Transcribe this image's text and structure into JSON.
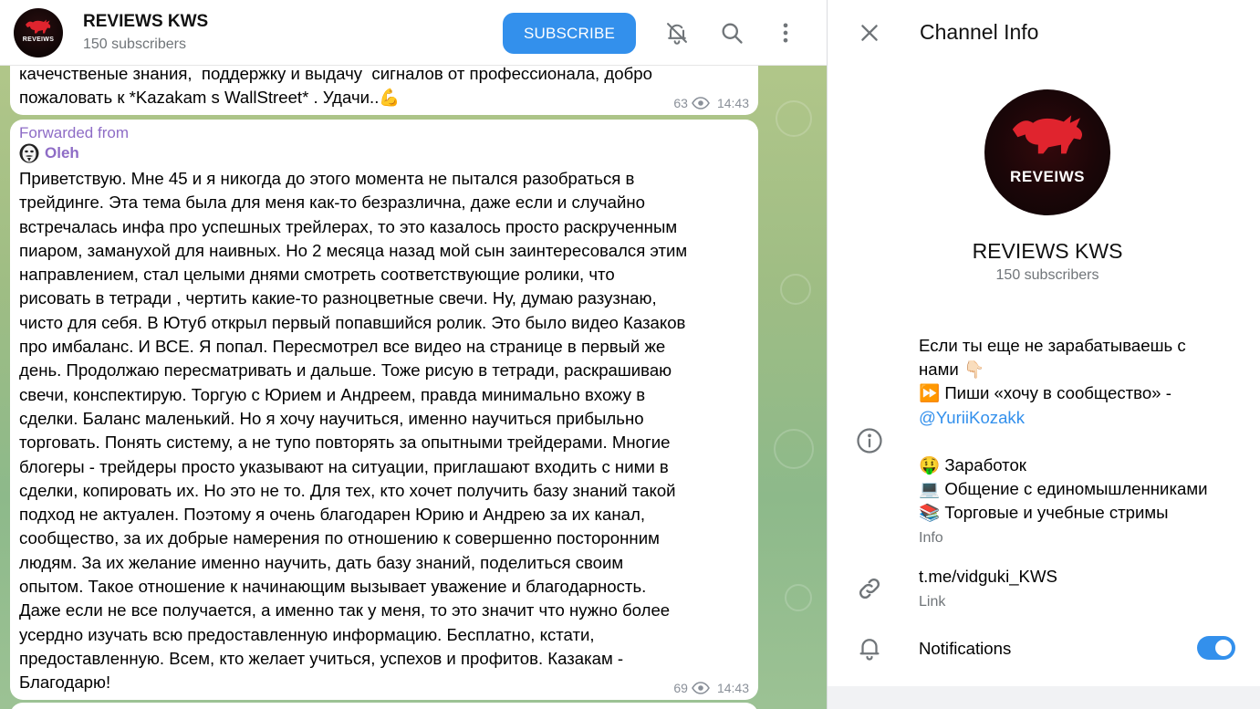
{
  "header": {
    "channel_name": "REVIEWS KWS",
    "subscribers": "150 subscribers",
    "avatar_brand": "REVEIWS",
    "subscribe_label": "SUBSCRIBE",
    "icons": [
      "bell-muted-icon",
      "search-icon",
      "more-vertical-icon"
    ]
  },
  "messages": [
    {
      "text": "качечственые знания,  поддержку и выдачу  сигналов от профессионала, добро\nпожаловать к *Kazakam s WallStreet* . Удачи..💪",
      "views": "63",
      "time": "14:43"
    },
    {
      "forwarded_label": "Forwarded from",
      "forwarded_author": "Oleh",
      "text": "Приветствую. Мне 45 и я никогда до этого момента не пытался разобраться в\nтрейдинге. Эта тема была для меня как-то безразлична, даже если и случайно\nвстречалась инфа про успешных трейлерах, то это казалось просто раскрученным\nпиаром, заманухой для наивных. Но 2 месяца назад мой сын заинтересовался этим\nнаправлением, стал целыми днями смотреть соответствующие ролики, что\nрисовать в тетради , чертить какие-то разноцветные свечи. Ну, думаю разузнаю,\nчисто для себя. В Ютуб открыл первый попавшийся ролик. Это было видео Казаков\nпро имбаланс. И ВСЕ. Я попал. Пересмотрел все видео на странице в первый же\nдень. Продолжаю пересматривать и дальше. Тоже рисую в тетради, раскрашиваю\nсвечи, конспектирую. Торгую с Юрием и Андреем, правда минимально вхожу в\nсделки. Баланс маленький. Но я хочу научиться, именно научиться прибыльно\nторговать. Понять систему, а не тупо повторять за опытными трейдерами. Многие\nблогеры - трейдеры просто указывают на ситуации, приглашают входить с ними в\nсделки, копировать их. Но это не то. Для тех, кто хочет получить базу знаний такой\nподход не актуален. Поэтому я очень благодарен Юрию и Андрею за их канал,\nсообщество, за их добрые намерения по отношению к совершенно посторонним\nлюдям. За их желание именно научить, дать базу знаний, поделиться своим\nопытом. Такое отношение к начинающим вызывает уважение и благодарность.\nДаже если не все получается, а именно так у меня, то это значит что нужно более\nусердно изучать всю предоставленную информацию. Бесплатно, кстати,\nпредоставленную. Всем, кто желает учиться, успехов и профитов. Казакам -\nБлагодарю!",
      "views": "69",
      "time": "14:43"
    }
  ],
  "info_panel": {
    "title": "Channel Info",
    "avatar_brand": "REVEIWS",
    "name": "REVIEWS KWS",
    "subscribers": "150 subscribers",
    "description": {
      "line1": "Если ты еще не зарабатываешь с",
      "line2": "нами 👇🏻",
      "line3": "⏩ Пиши «хочу в сообщество» -",
      "link": "@YuriiKozakk",
      "bullet1": "🤑 Заработок",
      "bullet2": "💻 Общение с единомышленниками",
      "bullet3": "📚 Торговые и учебные стримы"
    },
    "description_caption": "Info",
    "link_value": "t.me/vidguki_KWS",
    "link_caption": "Link",
    "notifications_label": "Notifications",
    "notifications_on": true
  },
  "colors": {
    "accent": "#3390ec",
    "forward": "#8e6cc6",
    "muted": "#707579"
  }
}
